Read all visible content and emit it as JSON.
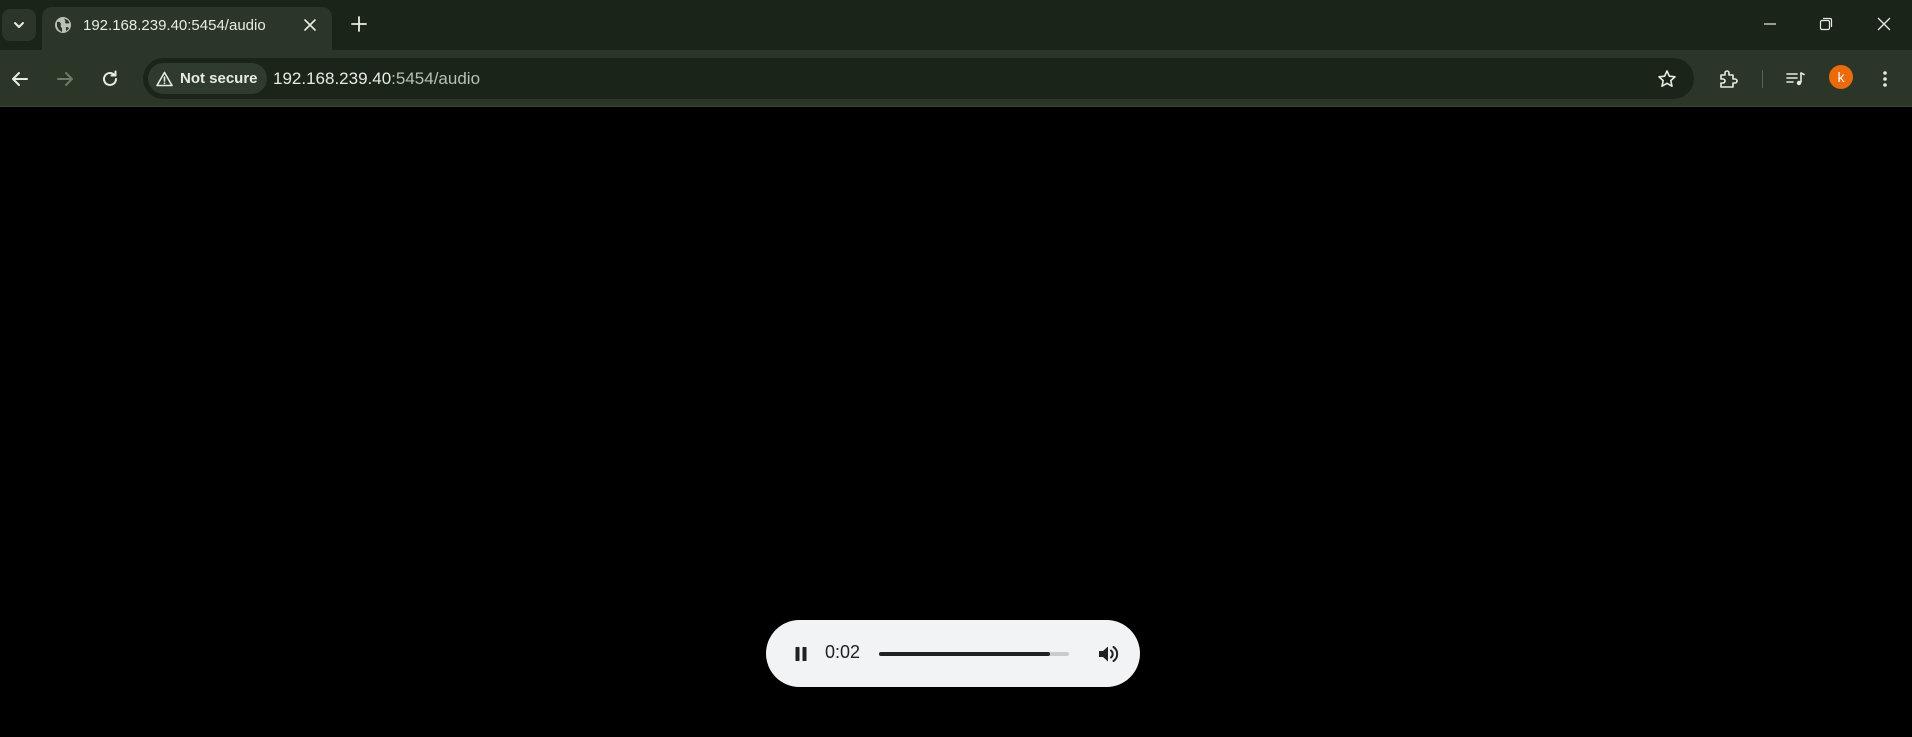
{
  "browser": {
    "tab": {
      "title": "192.168.239.40:5454/audio",
      "favicon": "globe-icon"
    },
    "address_bar": {
      "security_label": "Not secure",
      "url_host": "192.168.239.40",
      "url_rest": ":5454/audio"
    },
    "profile": {
      "initial": "k",
      "color": "#ea6a0c"
    },
    "colors": {
      "frame": "#1b2419",
      "toolbar": "#2b3628"
    }
  },
  "audio_player": {
    "state": "playing",
    "current_time": "0:02",
    "progress": 0.9
  }
}
